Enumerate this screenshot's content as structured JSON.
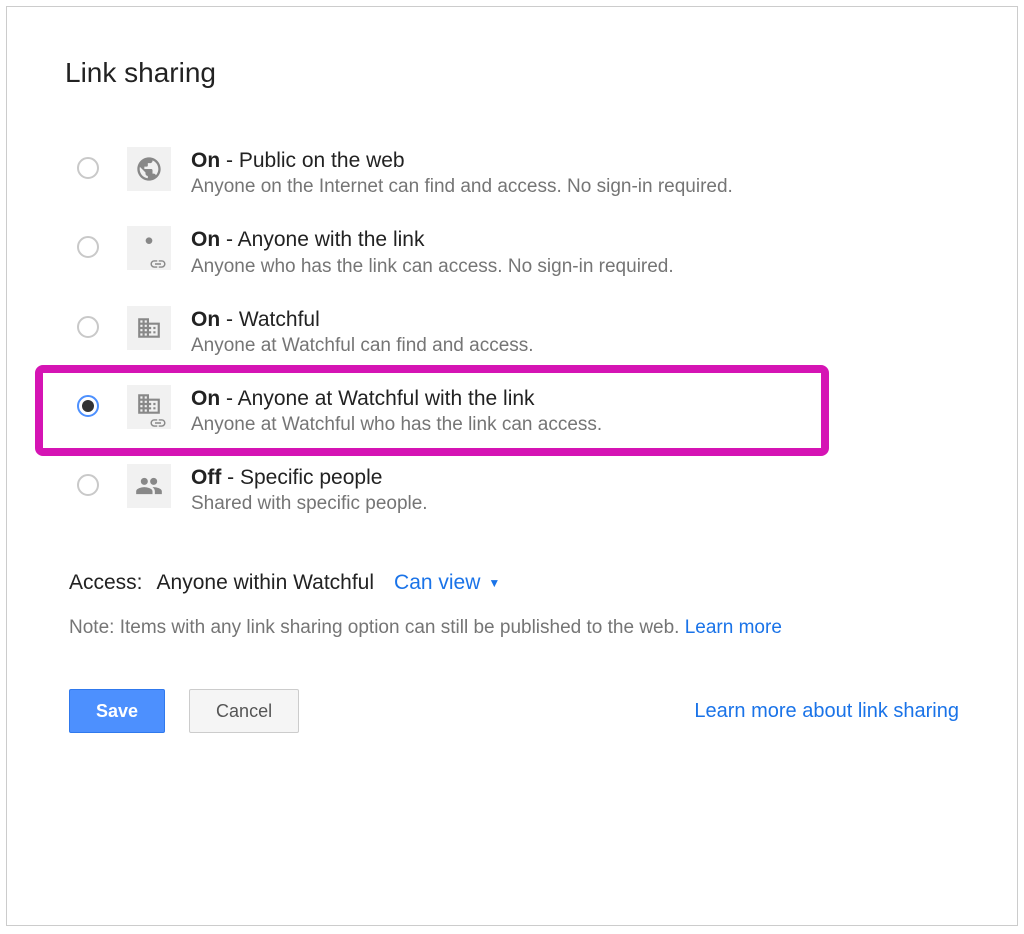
{
  "title": "Link sharing",
  "options": [
    {
      "state": "On",
      "suffix": " - Public on the web",
      "desc": "Anyone on the Internet can find and access. No sign-in required.",
      "icon": "globe-icon",
      "selected": false
    },
    {
      "state": "On",
      "suffix": " - Anyone with the link",
      "desc": "Anyone who has the link can access. No sign-in required.",
      "icon": "person-link-icon",
      "selected": false
    },
    {
      "state": "On",
      "suffix": " - Watchful",
      "desc": "Anyone at Watchful can find and access.",
      "icon": "building-icon",
      "selected": false
    },
    {
      "state": "On",
      "suffix": " - Anyone at Watchful with the link",
      "desc": "Anyone at Watchful who has the link can access.",
      "icon": "building-link-icon",
      "selected": true,
      "highlighted": true
    },
    {
      "state": "Off",
      "suffix": " - Specific people",
      "desc": "Shared with specific people.",
      "icon": "people-icon",
      "selected": false
    }
  ],
  "access": {
    "label": "Access:",
    "value": "Anyone within Watchful",
    "permission": "Can view"
  },
  "note": {
    "text": "Note: Items with any link sharing option can still be published to the web. ",
    "link": "Learn more"
  },
  "buttons": {
    "save": "Save",
    "cancel": "Cancel"
  },
  "helpLink": "Learn more about link sharing"
}
